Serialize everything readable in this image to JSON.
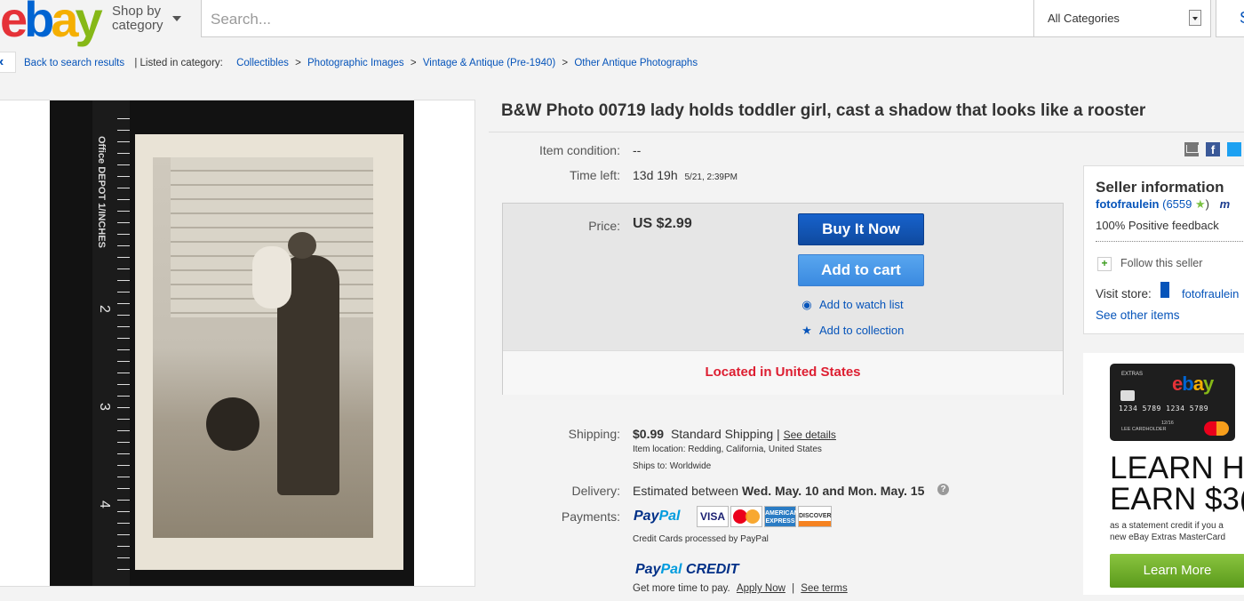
{
  "header": {
    "logo": "ebay",
    "shop_by": "Shop by",
    "shop_by_2": "category",
    "search_placeholder": "Search...",
    "categories": "All Categories",
    "search_button": "S"
  },
  "breadcrumb": {
    "back": "Back to search results",
    "listed_in": "| Listed in category:",
    "items": [
      "Collectibles",
      "Photographic Images",
      "Vintage & Antique (Pre-1940)",
      "Other Antique Photographs"
    ],
    "sep": ">"
  },
  "photo": {
    "ruler_label": "Office DEPOT  1/INCHES",
    "ruler_numbers": [
      "2",
      "3",
      "4"
    ]
  },
  "item": {
    "title": "B&W Photo 00719 lady holds toddler girl, cast a shadow that looks like a rooster",
    "condition_label": "Item condition:",
    "condition_value": "--",
    "time_left_label": "Time left:",
    "time_left_value": "13d 19h",
    "time_left_date": "5/21, 2:39PM"
  },
  "purchase": {
    "price_label": "Price:",
    "price_value": "US $2.99",
    "buy_now": "Buy It Now",
    "add_to_cart": "Add to cart",
    "watch": "Add to watch list",
    "collection": "Add to collection",
    "located": "Located in United States"
  },
  "shipping": {
    "label": "Shipping:",
    "amount": "$0.99",
    "method": "Standard Shipping",
    "divider": "|",
    "details_link": "See details",
    "location": "Item location:  Redding, California, United States",
    "ships_to": "Ships to:  Worldwide"
  },
  "delivery": {
    "label": "Delivery:",
    "prefix": "Estimated between",
    "dates": "Wed. May. 10 and Mon. May. 15",
    "help": "?"
  },
  "payments": {
    "label": "Payments:",
    "paypal_1": "Pay",
    "paypal_2": "Pal",
    "cards": [
      "VISA",
      "MasterCard",
      "AMERICAN EXPRESS",
      "DISCOVER"
    ],
    "processed": "Credit Cards processed by PayPal",
    "credit_1": "Pay",
    "credit_2": "Pal",
    "credit_3": " CREDIT",
    "credit_sub": "Get more time to pay.",
    "apply_link": "Apply Now",
    "terms_divider": "|",
    "terms_link": "See terms"
  },
  "seller": {
    "title": "Seller information",
    "name": "fotofraulein",
    "score": "(6559",
    "score_close": ")",
    "star": "★",
    "me_badge": "m",
    "feedback": "100% Positive feedback",
    "follow": "Follow this seller",
    "follow_icon": "+",
    "visit_store": "Visit store:",
    "store_name": "fotofraulein",
    "other_items": "See other items"
  },
  "ad": {
    "card_extras": "EXTRAS",
    "card_logo": "ebay",
    "card_number": "1234 5789 1234 5789",
    "card_expiry": "12/16",
    "card_holder": "LEE CARDHOLDER",
    "headline_1": "LEARN H",
    "headline_2": "EARN $3(",
    "sub_1": "as a statement credit if you a",
    "sub_2": "new eBay Extras MasterCard",
    "cta": "Learn More"
  },
  "colors": {
    "link": "#0654ba",
    "buy_now": "#0f4dad",
    "add_to_cart": "#3a8ae0",
    "located": "#dd1e31",
    "learn_more": "#6fae2b"
  }
}
